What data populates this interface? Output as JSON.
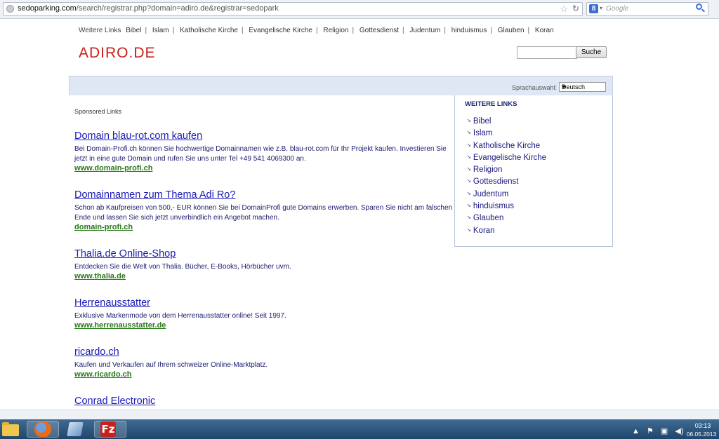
{
  "browser": {
    "url_prefix": "sedoparking.com",
    "url_rest": "/search/registrar.php?domain=adiro.de&registrar=sedopark",
    "search_engine_label": "Google"
  },
  "topnav": {
    "lead": "Weitere Links",
    "items": [
      "Bibel",
      "Islam",
      "Katholische Kirche",
      "Evangelische Kirche",
      "Religion",
      "Gottesdienst",
      "Judentum",
      "hinduismus",
      "Glauben",
      "Koran"
    ],
    "separator": "|"
  },
  "logo": "ADIRO.DE",
  "site_search": {
    "button": "Suche"
  },
  "language": {
    "label": "Sprachauswahl:",
    "selected": "Deutsch"
  },
  "sponsored_label": "Sponsored Links",
  "ads": [
    {
      "title": "Domain blau-rot.com kaufen",
      "desc": "Bei Domain-Profi.ch können Sie hochwertige Domainnamen wie z.B. blau-rot.com für Ihr Projekt kaufen. Investieren Sie jetzt in eine gute Domain und rufen Sie uns unter Tel +49 541 4069300 an.",
      "url": "www.domain-profi.ch"
    },
    {
      "title": "Domainnamen zum Thema Adi Ro?",
      "desc": "Schon ab Kaufpreisen von 500,- EUR können Sie bei DomainProfi gute Domains erwerben. Sparen Sie nicht am falschen Ende und lassen Sie sich jetzt unverbindlich ein Angebot machen.",
      "url": "domain-profi.ch"
    },
    {
      "title": "Thalia.de Online-Shop",
      "desc": "Entdecken Sie die Welt von Thalia. Bücher, E-Books, Hörbücher uvm.",
      "url": "www.thalia.de"
    },
    {
      "title": "Herrenausstatter",
      "desc": "Exklusive Markenmode von dem Herrenausstatter online! Seit 1997.",
      "url": "www.herrenausstatter.de"
    },
    {
      "title": "ricardo.ch",
      "desc": "Kaufen und Verkaufen auf Ihrem schweizer Online-Marktplatz.",
      "url": "www.ricardo.ch"
    },
    {
      "title": "Conrad Electronic",
      "desc": "",
      "url": ""
    }
  ],
  "sidebar": {
    "title": "WEITERE LINKS",
    "items": [
      "Bibel",
      "Islam",
      "Katholische Kirche",
      "Evangelische Kirche",
      "Religion",
      "Gottesdienst",
      "Judentum",
      "hinduismus",
      "Glauben",
      "Koran"
    ]
  },
  "taskbar": {
    "time": "03:13",
    "date": "06.05.2013",
    "filezilla_glyph": "Fz"
  },
  "colors": {
    "logo": "#c8201a",
    "ad_title": "#1a1ab5",
    "ad_url": "#2a7a1a",
    "band": "#dfe6f4"
  }
}
